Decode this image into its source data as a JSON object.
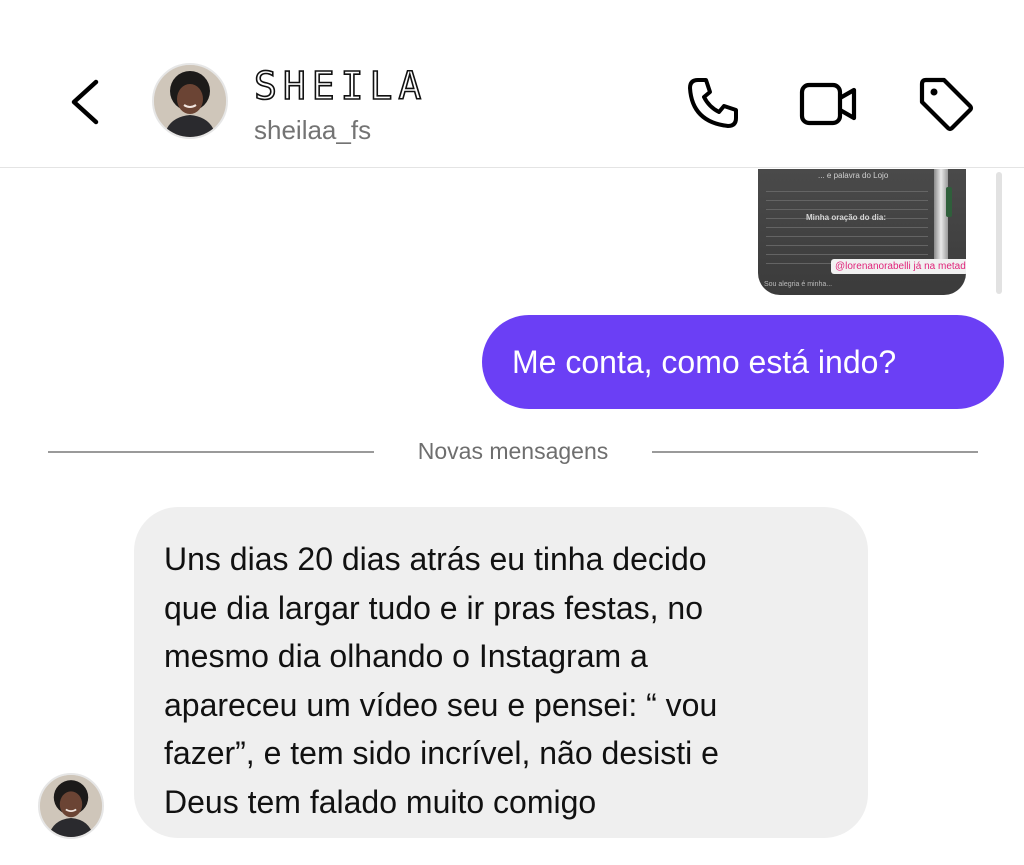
{
  "header": {
    "contact_name": "SHEILA",
    "username": "sheilaa_fs"
  },
  "icons": {
    "back": "chevron-left-icon",
    "phone": "phone-icon",
    "video": "video-camera-icon",
    "tag": "tag-icon"
  },
  "shared_post": {
    "heading_top": "... e palavra do Lojo",
    "heading_mid": "Minha oração do dia:",
    "footer_text": "Sou alegria é minha...",
    "mention": "@lorenanorabelli já na metade",
    "mention_heart": "❤️"
  },
  "messages": {
    "outgoing": "Me conta, como está indo?",
    "divider": "Novas mensagens",
    "incoming_lines": [
      "Uns dias 20 dias atrás eu tinha decido",
      "que dia largar tudo e ir pras festas, no",
      "mesmo dia olhando o Instagram a",
      "apareceu um vídeo seu e pensei: “ vou",
      "fazer”, e tem sido incrível, não desisti e",
      "Deus tem falado muito comigo"
    ]
  },
  "colors": {
    "outgoing_bubble": "#6b3ff5",
    "incoming_bubble": "#efefef",
    "username_gray": "#737373"
  }
}
